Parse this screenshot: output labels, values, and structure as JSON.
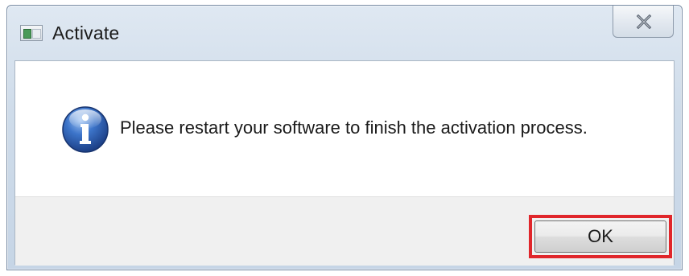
{
  "window": {
    "title": "Activate",
    "close_icon": "close-x-icon",
    "app_icon": "app-window-icon"
  },
  "message": {
    "icon": "info-icon",
    "text": "Please restart your software to finish the activation process."
  },
  "buttons": {
    "ok_label": "OK"
  },
  "colors": {
    "highlight_border": "#e0262b",
    "info_icon_blue": "#2a5fb4"
  }
}
